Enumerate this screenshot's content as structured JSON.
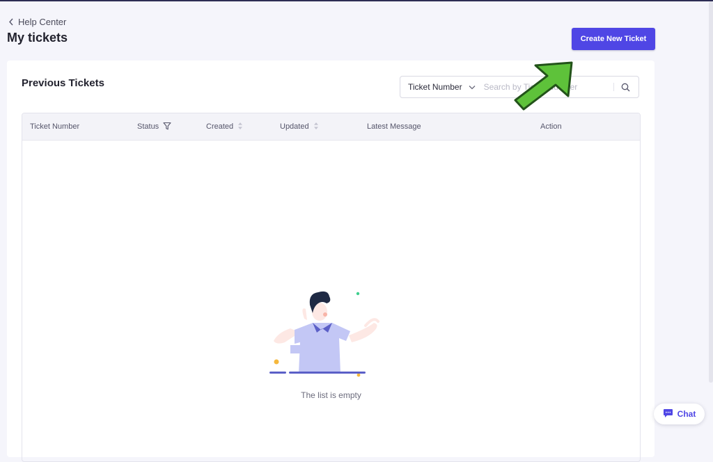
{
  "colors": {
    "accent": "#4f46e5",
    "arrow_green": "#5ec23a"
  },
  "breadcrumb": {
    "icon": "chevron-left-icon",
    "label": "Help Center"
  },
  "page": {
    "title": "My tickets"
  },
  "header": {
    "create_button_label": "Create New Ticket"
  },
  "tickets_card": {
    "title": "Previous Tickets",
    "search": {
      "type_selected": "Ticket Number",
      "type_dropdown_icon": "chevron-down-icon",
      "placeholder": "Search by Ticket Number",
      "icon": "search-icon"
    },
    "table": {
      "columns": [
        {
          "label": "Ticket Number"
        },
        {
          "label": "Status",
          "icon": "filter-icon"
        },
        {
          "label": "Created",
          "icon": "sort-icon"
        },
        {
          "label": "Updated",
          "icon": "sort-icon"
        },
        {
          "label": "Latest Message"
        },
        {
          "label": "Action"
        }
      ],
      "rows": [],
      "empty_text": "The list is empty"
    }
  },
  "chat_widget": {
    "icon": "chat-bubble-icon",
    "label": "Chat"
  }
}
